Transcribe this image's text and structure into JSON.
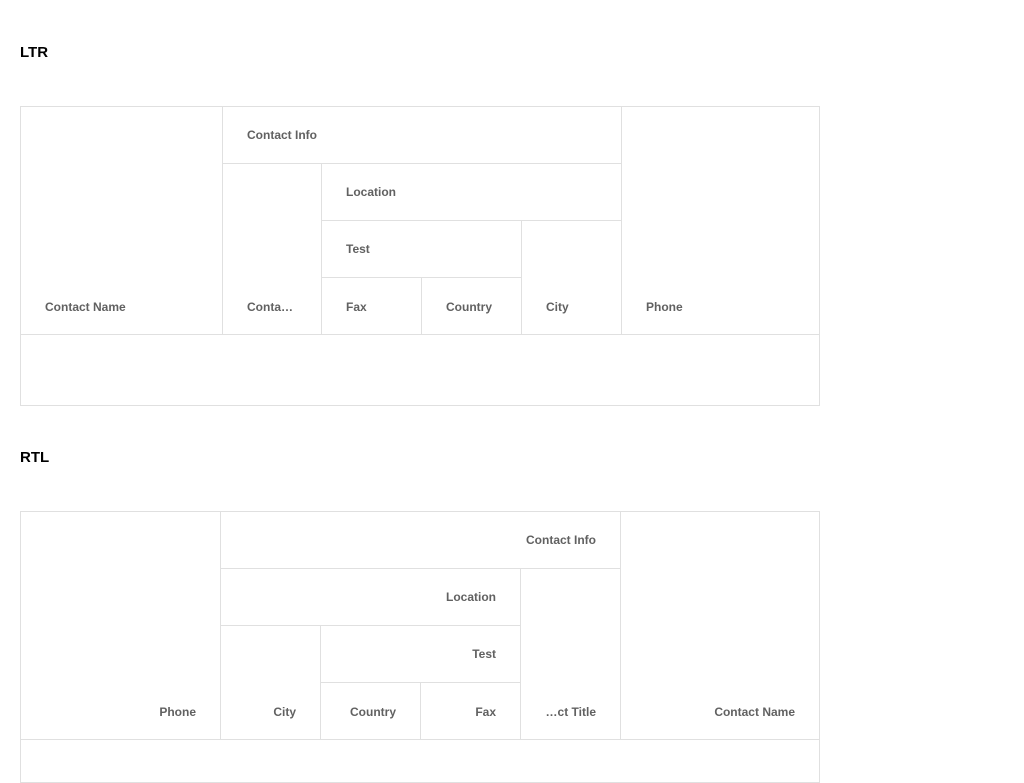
{
  "sections": {
    "ltr": {
      "title": "LTR",
      "headers": {
        "contact_name": "Contact Name",
        "contact_info": "Contact Info",
        "contact_title": "Contact Title",
        "location": "Location",
        "test": "Test",
        "fax": "Fax",
        "country": "Country",
        "city": "City",
        "phone": "Phone"
      }
    },
    "rtl": {
      "title": "RTL",
      "headers": {
        "contact_name": "Contact Name",
        "contact_info": "Contact Info",
        "contact_title": "Contact Title",
        "location": "Location",
        "test": "Test",
        "fax": "Fax",
        "country": "Country",
        "city": "City",
        "phone": "Phone"
      }
    }
  },
  "colors": {
    "header_text": "#616161",
    "border": "#e0e0e0",
    "title_text": "#000000"
  }
}
